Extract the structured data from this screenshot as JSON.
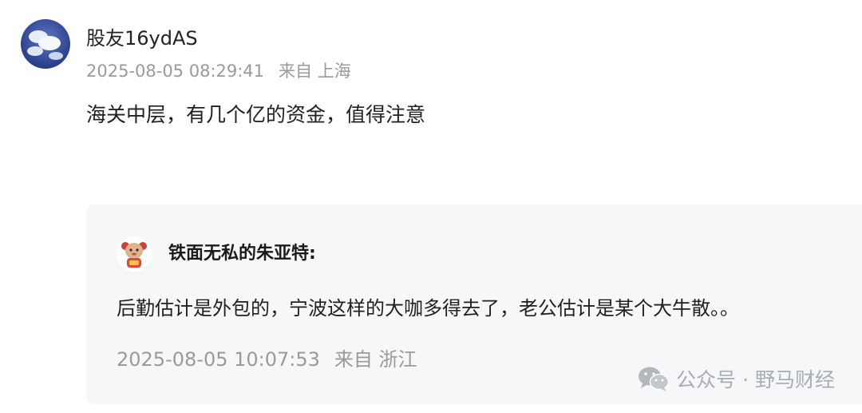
{
  "comment": {
    "avatar_icon": "sky-cloud-avatar-icon",
    "username": "股友16ydAS",
    "timestamp": "2025-08-05 08:29:41",
    "location": "来自 上海",
    "text": "海关中层，有几个亿的资金，值得注意"
  },
  "reply": {
    "avatar_icon": "cartoon-character-avatar-icon",
    "author": "铁面无私的朱亚特:",
    "text": "后勤估计是外包的，宁波这样的大咖多得去了，老公估计是某个大牛散。。",
    "timestamp": "2025-08-05 10:07:53",
    "location": "来自 浙江"
  },
  "watermark": {
    "icon": "wechat-icon",
    "text": "公众号 · 野马财经"
  }
}
